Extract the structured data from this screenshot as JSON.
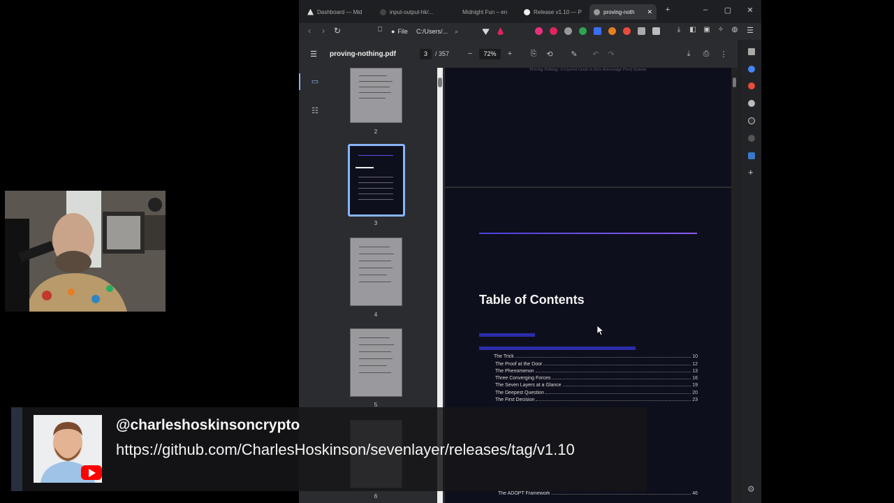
{
  "browser": {
    "tabs": [
      {
        "label": "Dashboard — Mid"
      },
      {
        "label": "input-output-hk/..."
      },
      {
        "label": "Midnight Fun – en"
      },
      {
        "label": "Release v1.10 — P"
      },
      {
        "label": "proving-noth"
      }
    ],
    "address": {
      "scheme": "File",
      "path": "C:/Users/..."
    }
  },
  "pdf_viewer": {
    "filename": "proving-nothing.pdf",
    "current_page": "3",
    "total_pages": "/ 357",
    "zoom": "72%",
    "thumbnails": [
      {
        "number": "2"
      },
      {
        "number": "3"
      },
      {
        "number": "4"
      },
      {
        "number": "5"
      },
      {
        "number": "6"
      }
    ],
    "page_header": "Proving Nothing: A Layered Guide to Zero-Knowledge Proof Systems",
    "toc_title": "Table of Contents",
    "toc_entries": [
      {
        "title": "The Trick",
        "page": "10"
      },
      {
        "title": "The Proof at the Door",
        "page": "12"
      },
      {
        "title": "The Phenomenon",
        "page": "13"
      },
      {
        "title": "Three Converging Forces",
        "page": "16"
      },
      {
        "title": "The Seven Layers at a Glance",
        "page": "19"
      },
      {
        "title": "The Deepest Question",
        "page": "20"
      },
      {
        "title": "The First Decision",
        "page": "23"
      },
      {
        "title": "The ADOPT Framework",
        "page": "46"
      }
    ]
  },
  "overlay": {
    "handle": "@charleshoskinsoncrypto",
    "link": "https://github.com/CharlesHoskinson/sevenlayer/releases/tag/v1.10"
  },
  "colors": {
    "accent": "#6f5cf0",
    "selected_thumb": "#8ab4f8",
    "youtube_red": "#ff0000"
  }
}
